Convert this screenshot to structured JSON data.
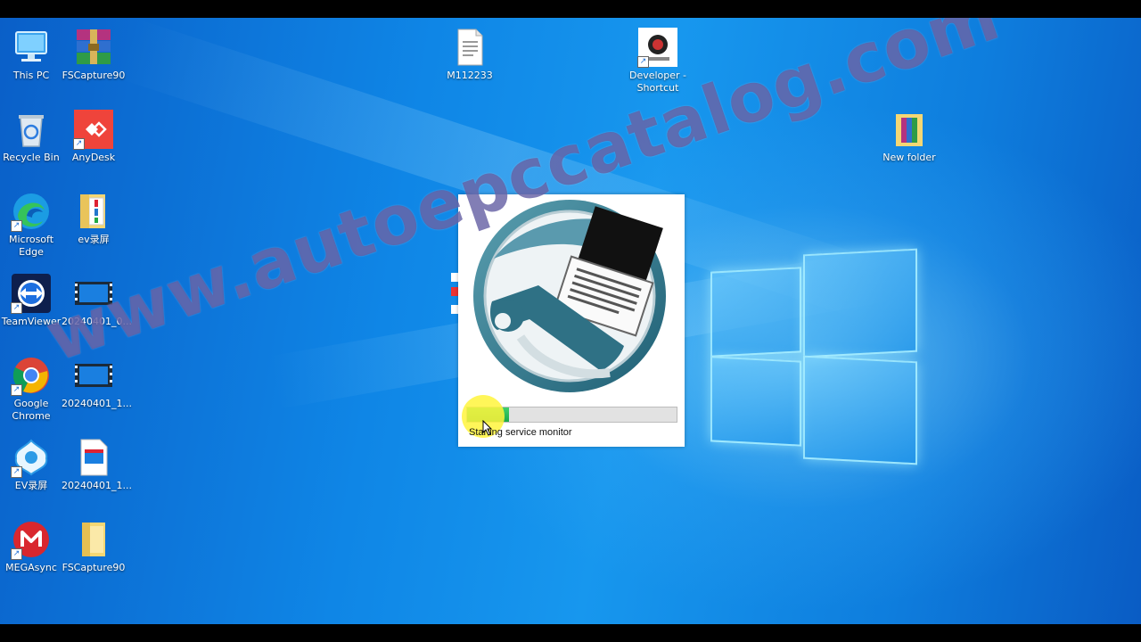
{
  "desktop": {
    "icons": [
      {
        "label": "This PC"
      },
      {
        "label": "FSCapture90"
      },
      {
        "label": "Recycle Bin"
      },
      {
        "label": "AnyDesk"
      },
      {
        "label": "Microsoft\nEdge"
      },
      {
        "label": "ev录屏"
      },
      {
        "label": "TeamViewer"
      },
      {
        "label": "20240401_0..."
      },
      {
        "label": "Google\nChrome"
      },
      {
        "label": "20240401_1..."
      },
      {
        "label": "EV录屏"
      },
      {
        "label": "20240401_1..."
      },
      {
        "label": "MEGAsync"
      },
      {
        "label": "FSCapture90"
      },
      {
        "label": "M112233"
      },
      {
        "label": "Developer -\nShortcut"
      },
      {
        "label": "New folder"
      }
    ]
  },
  "splash": {
    "status": "Starting service monitor",
    "progress_fraction": 0.2
  },
  "watermark": "www.autoepccatalog.com",
  "colors": {
    "desktop_blue": "#0f86e6",
    "progress_green": "#1ba84a",
    "watermark": "#5f5aa0"
  }
}
